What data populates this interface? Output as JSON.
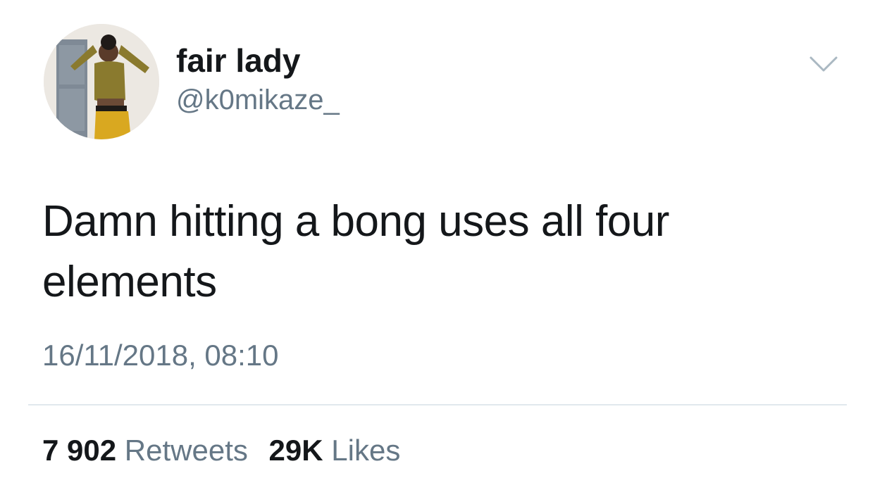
{
  "tweet": {
    "display_name": "fair lady",
    "handle": "@k0mikaze_",
    "text": "Damn hitting a bong uses all four elements",
    "timestamp": "16/11/2018, 08:10",
    "retweets_count": "7 902",
    "retweets_label": "Retweets",
    "likes_count": "29K",
    "likes_label": "Likes"
  },
  "icons": {
    "menu": "chevron-down-icon",
    "avatar": "avatar"
  },
  "colors": {
    "text_primary": "#14171a",
    "text_secondary": "#657786",
    "divider": "#e1e8ed",
    "background": "#ffffff"
  }
}
